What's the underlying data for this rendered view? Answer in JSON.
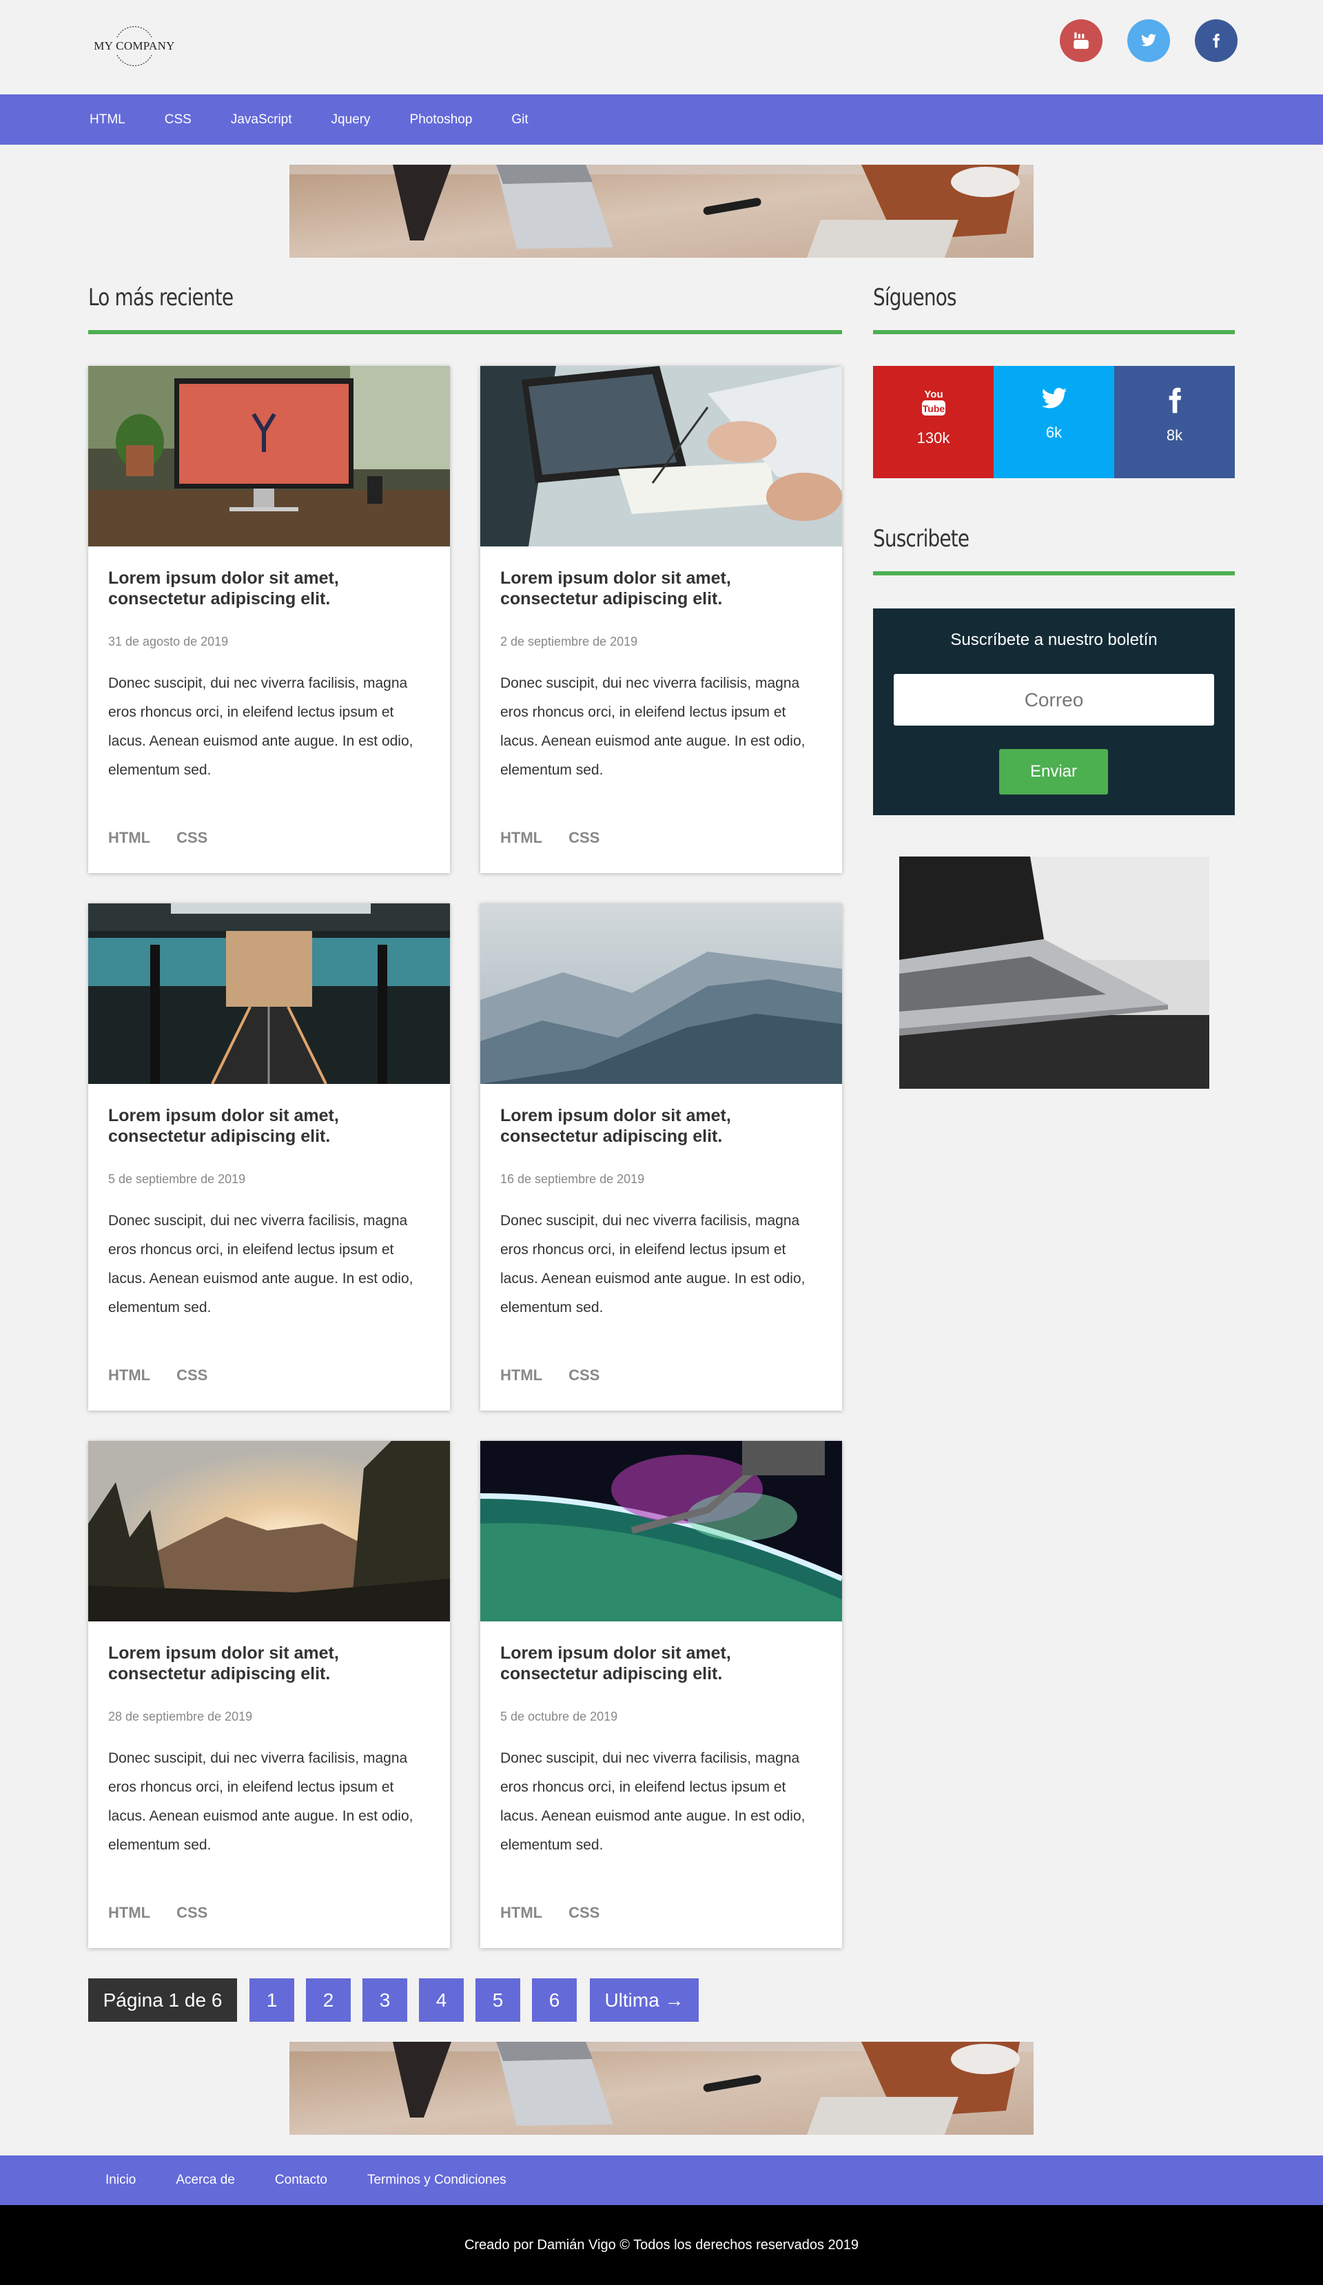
{
  "header": {
    "logo_text": "MY COMPANY",
    "social": [
      {
        "name": "youtube",
        "icon": "youtube-icon",
        "color": "#c9504f"
      },
      {
        "name": "twitter",
        "icon": "twitter-icon",
        "color": "#55acee"
      },
      {
        "name": "facebook",
        "icon": "facebook-icon",
        "color": "#3b5998"
      }
    ]
  },
  "nav": {
    "items": [
      "HTML",
      "CSS",
      "JavaScript",
      "Jquery",
      "Photoshop",
      "Git"
    ]
  },
  "main": {
    "title": "Lo más reciente",
    "posts": [
      {
        "title": "Lorem ipsum dolor sit amet, consectetur adipiscing elit.",
        "date": "31 de agosto de 2019",
        "excerpt": "Donec suscipit, dui nec viverra facilisis, magna eros rhoncus orci, in eleifend lectus ipsum et lacus. Aenean euismod ante augue. In est odio, elementum sed.",
        "tags": [
          "HTML",
          "CSS"
        ]
      },
      {
        "title": "Lorem ipsum dolor sit amet, consectetur adipiscing elit.",
        "date": "2 de septiembre de 2019",
        "excerpt": "Donec suscipit, dui nec viverra facilisis, magna eros rhoncus orci, in eleifend lectus ipsum et lacus. Aenean euismod ante augue. In est odio, elementum sed.",
        "tags": [
          "HTML",
          "CSS"
        ]
      },
      {
        "title": "Lorem ipsum dolor sit amet, consectetur adipiscing elit.",
        "date": "5 de septiembre de 2019",
        "excerpt": "Donec suscipit, dui nec viverra facilisis, magna eros rhoncus orci, in eleifend lectus ipsum et lacus. Aenean euismod ante augue. In est odio, elementum sed.",
        "tags": [
          "HTML",
          "CSS"
        ]
      },
      {
        "title": "Lorem ipsum dolor sit amet, consectetur adipiscing elit.",
        "date": "16 de septiembre de 2019",
        "excerpt": "Donec suscipit, dui nec viverra facilisis, magna eros rhoncus orci, in eleifend lectus ipsum et lacus. Aenean euismod ante augue. In est odio, elementum sed.",
        "tags": [
          "HTML",
          "CSS"
        ]
      },
      {
        "title": "Lorem ipsum dolor sit amet, consectetur adipiscing elit.",
        "date": "28 de septiembre de 2019",
        "excerpt": "Donec suscipit, dui nec viverra facilisis, magna eros rhoncus orci, in eleifend lectus ipsum et lacus. Aenean euismod ante augue. In est odio, elementum sed.",
        "tags": [
          "HTML",
          "CSS"
        ]
      },
      {
        "title": "Lorem ipsum dolor sit amet, consectetur adipiscing elit.",
        "date": "5 de octubre de 2019",
        "excerpt": "Donec suscipit, dui nec viverra facilisis, magna eros rhoncus orci, in eleifend lectus ipsum et lacus. Aenean euismod ante augue. In est odio, elementum sed.",
        "tags": [
          "HTML",
          "CSS"
        ]
      }
    ]
  },
  "sidebar": {
    "follow_title": "Síguenos",
    "social": [
      {
        "name": "youtube",
        "icon": "youtube-icon",
        "count": "130k",
        "color": "#cd201f"
      },
      {
        "name": "twitter",
        "icon": "twitter-icon",
        "count": "6k",
        "color": "#03a9f4"
      },
      {
        "name": "facebook",
        "icon": "facebook-icon",
        "count": "8k",
        "color": "#3b5998"
      }
    ],
    "subscribe_title": "Suscribete",
    "newsletter": {
      "title": "Suscríbete a nuestro boletín",
      "placeholder": "Correo",
      "button": "Enviar"
    }
  },
  "pagination": {
    "info": "Página 1 de 6",
    "pages": [
      "1",
      "2",
      "3",
      "4",
      "5",
      "6"
    ],
    "last": "Ultima →"
  },
  "footer": {
    "links": [
      "Inicio",
      "Acerca de",
      "Contacto",
      "Terminos y Condiciones"
    ],
    "copyright": "Creado por Damián Vigo © Todos los derechos reservados 2019"
  },
  "colors": {
    "accent": "#646ad8",
    "green": "#4caf50",
    "newsletter_bg": "#142b36"
  }
}
